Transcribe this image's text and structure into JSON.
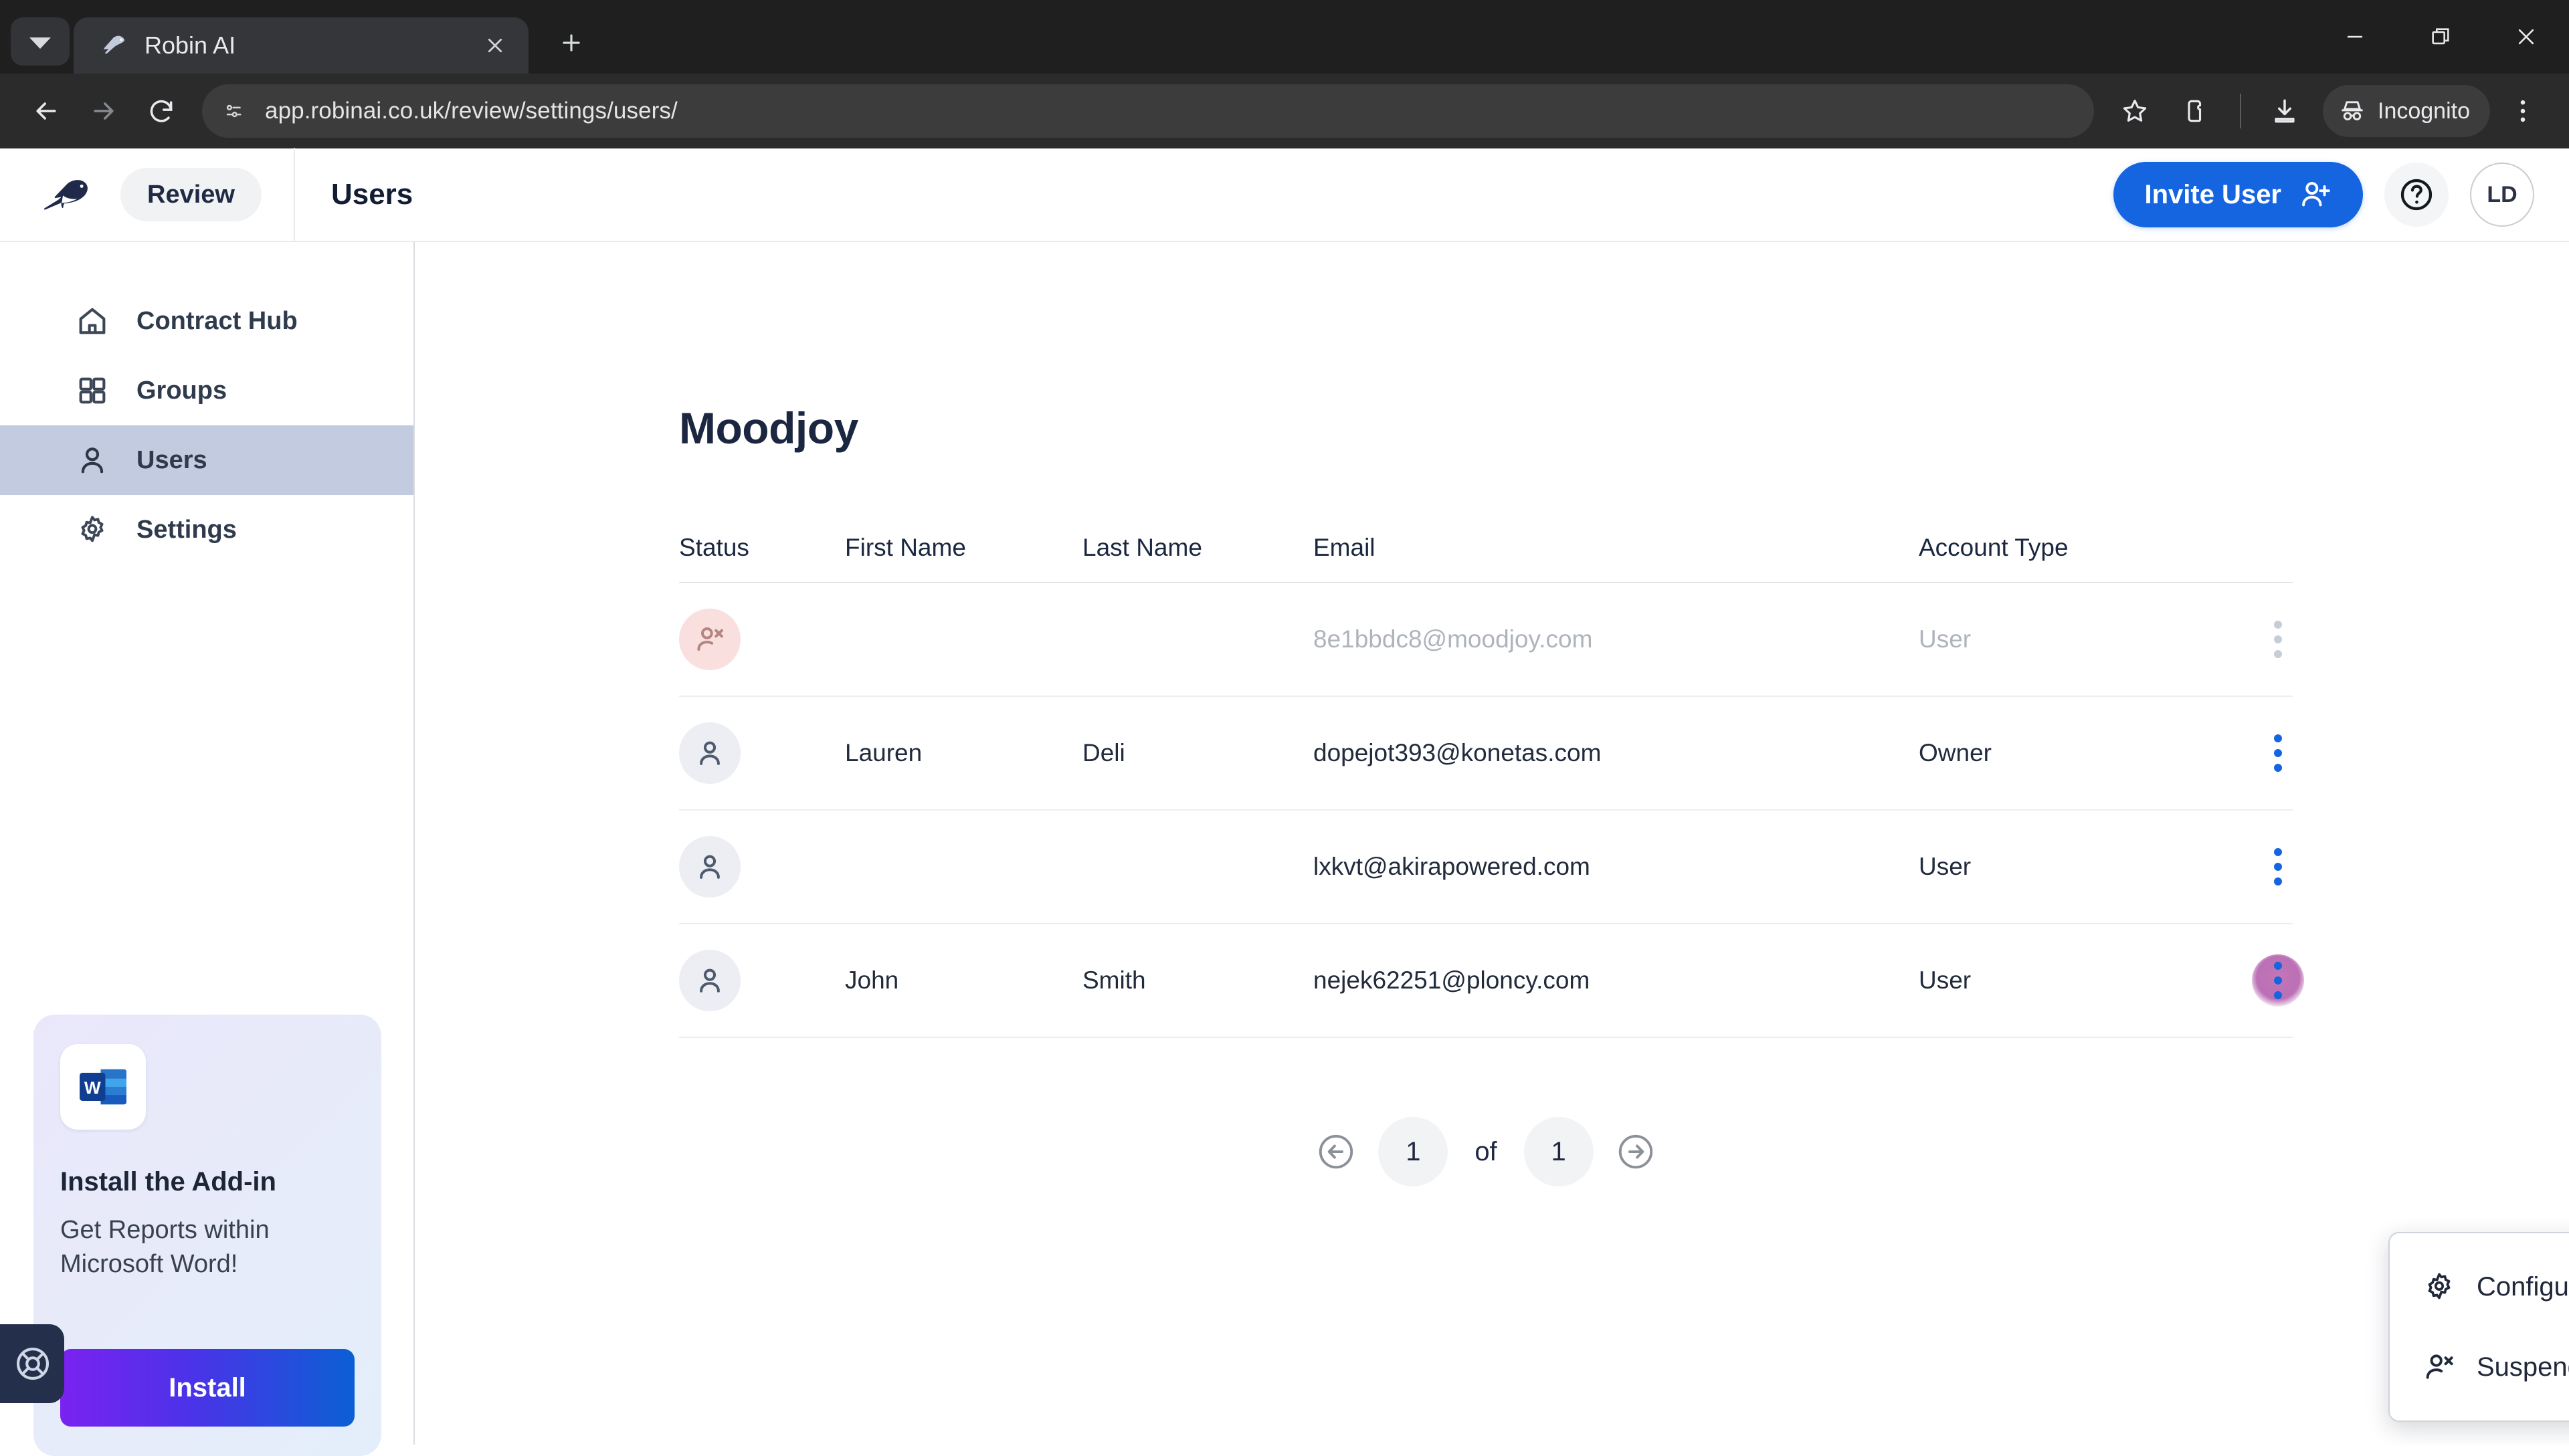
{
  "browser": {
    "tab": {
      "title": "Robin AI",
      "favicon_icon": "robin-bird-icon"
    },
    "tab_list_icon": "chevron-down-icon",
    "new_tab_icon": "plus-icon",
    "window_controls": {
      "minimize": "minimize-icon",
      "maximize": "restore-icon",
      "close": "close-icon"
    },
    "nav": {
      "back": "back-arrow-icon",
      "forward": "forward-arrow-icon",
      "reload": "reload-icon"
    },
    "omnibox": {
      "site_info_icon": "page-info-icon",
      "url": "app.robinai.co.uk/review/settings/users/"
    },
    "actions": {
      "bookmark_icon": "star-icon",
      "extensions_icon": "extensions-icon",
      "download_icon": "download-icon",
      "incognito_label": "Incognito",
      "incognito_icon": "incognito-hat-icon",
      "menu_icon": "three-dot-vertical-icon"
    }
  },
  "appbar": {
    "logo_icon": "robin-bird-logo",
    "workspace_label": "Review",
    "page_title": "Users",
    "invite_button": {
      "label": "Invite User",
      "icon": "user-plus-icon"
    },
    "help_icon": "question-circle-icon",
    "avatar_initials": "LD",
    "accent_color": "#1565e0"
  },
  "sidebar": {
    "items": [
      {
        "label": "Contract Hub",
        "icon": "home-icon",
        "active": false
      },
      {
        "label": "Groups",
        "icon": "grid-icon",
        "active": false
      },
      {
        "label": "Users",
        "icon": "user-icon",
        "active": true
      },
      {
        "label": "Settings",
        "icon": "gear-icon",
        "active": false
      }
    ],
    "promo": {
      "icon": "microsoft-word-icon",
      "title": "Install the Add-in",
      "subtitle": "Get Reports within Microsoft Word!",
      "button_label": "Install"
    },
    "support_icon": "lifebuoy-icon"
  },
  "main": {
    "org_name": "Moodjoy",
    "table": {
      "columns": [
        "Status",
        "First Name",
        "Last Name",
        "Email",
        "Account Type"
      ],
      "rows": [
        {
          "status": "suspended",
          "status_icon": "user-x-icon",
          "first_name": "",
          "last_name": "",
          "email": "8e1bbdc8@moodjoy.com",
          "account_type": "User",
          "menu_icon": "kebab-menu-icon"
        },
        {
          "status": "active",
          "status_icon": "user-icon",
          "first_name": "Lauren",
          "last_name": "Deli",
          "email": "dopejot393@konetas.com",
          "account_type": "Owner",
          "menu_icon": "kebab-menu-icon"
        },
        {
          "status": "active",
          "status_icon": "user-icon",
          "first_name": "",
          "last_name": "",
          "email": "lxkvt@akirapowered.com",
          "account_type": "User",
          "menu_icon": "kebab-menu-icon"
        },
        {
          "status": "active",
          "status_icon": "user-icon",
          "first_name": "John",
          "last_name": "Smith",
          "email": "nejek62251@ploncy.com",
          "account_type": "User",
          "menu_icon": "kebab-menu-icon"
        }
      ]
    },
    "row_menu": {
      "items": [
        {
          "label": "Configure",
          "icon": "gear-icon"
        },
        {
          "label": "Suspend",
          "icon": "user-x-icon"
        }
      ]
    },
    "pagination": {
      "prev_icon": "circle-left-arrow-icon",
      "next_icon": "circle-right-arrow-icon",
      "current_page": "1",
      "of_label": "of",
      "total_pages": "1"
    }
  }
}
